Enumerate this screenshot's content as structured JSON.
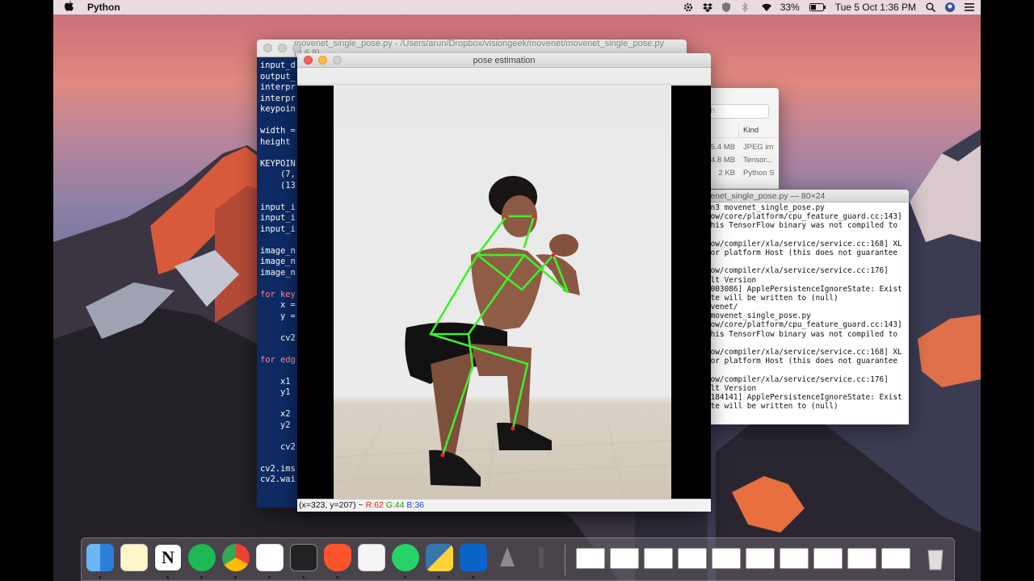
{
  "menubar": {
    "app_name": "Python",
    "battery": "33%",
    "clock": "Tue 5 Oct  1:36 PM"
  },
  "editor": {
    "title": "movenet_single_pose.py - /Users/arun/Dropbox/visiongeek/movenet/movenet_single_pose.py (3.6.8)",
    "lines": [
      "input_d",
      "output_",
      "interpr",
      "interpr",
      "keypoin",
      "",
      "width =",
      "height ",
      "",
      "KEYPOIN",
      "    (7,",
      "    (13",
      "",
      "input_i",
      "input_i",
      "input_i",
      "",
      "image_n",
      "image_n",
      "image_n",
      "",
      "for key",
      "    x =",
      "    y =",
      "",
      "    cv2",
      "",
      "for edg",
      "",
      "    x1",
      "    y1",
      "",
      "    x2",
      "    y2",
      "",
      "    cv2",
      "",
      "cv2.ims",
      "cv2.wai"
    ]
  },
  "pose_window": {
    "title": "pose estimation",
    "status_coords": "(x=323, y=207) ~ ",
    "status_r": "R:62",
    "status_g": "G:44",
    "status_b": "B:36"
  },
  "finder": {
    "search_placeholder": "rch",
    "kind_header": "Kind",
    "rows": [
      {
        "size": "5.4 MB",
        "kind": "JPEG im"
      },
      {
        "size": "4.8 MB",
        "kind": "Tensor..."
      },
      {
        "size": "2 KB",
        "kind": "Python S"
      }
    ]
  },
  "terminal": {
    "title": "venet_single_pose.py — 80×24",
    "lines": [
      "on3 movenet_single_pose.py",
      "low/core/platform/cpu_feature_guard.cc:143]",
      "this TensorFlow binary was not compiled to",
      "",
      "low/compiler/xla/service/service.cc:168] XL",
      "for platform Host (this does not guarantee",
      "",
      "low/compiler/xla/service/service.cc:176]",
      "ult Version",
      "1003086] ApplePersistenceIgnoreState: Exist",
      "ate will be written to (null)",
      "ovenet/",
      " movenet_single_pose.py",
      "low/core/platform/cpu_feature_guard.cc:143]",
      "this TensorFlow binary was not compiled to",
      "",
      "low/compiler/xla/service/service.cc:168] XL",
      "for platform Host (this does not guarantee",
      "",
      "low/compiler/xla/service/service.cc:176]",
      "ult Version",
      "1184141] ApplePersistenceIgnoreState: Exist",
      "ate will be written to (null)"
    ]
  },
  "dock": {
    "apps": [
      "finder-icon",
      "notes-icon",
      "notion-icon",
      "spotify-icon",
      "chrome-icon",
      "slack-icon",
      "terminal-icon",
      "brave-icon",
      "lasso-icon",
      "whatsapp-icon",
      "python-icon",
      "outlook-icon",
      "automator-icon",
      "pen-icon"
    ]
  }
}
